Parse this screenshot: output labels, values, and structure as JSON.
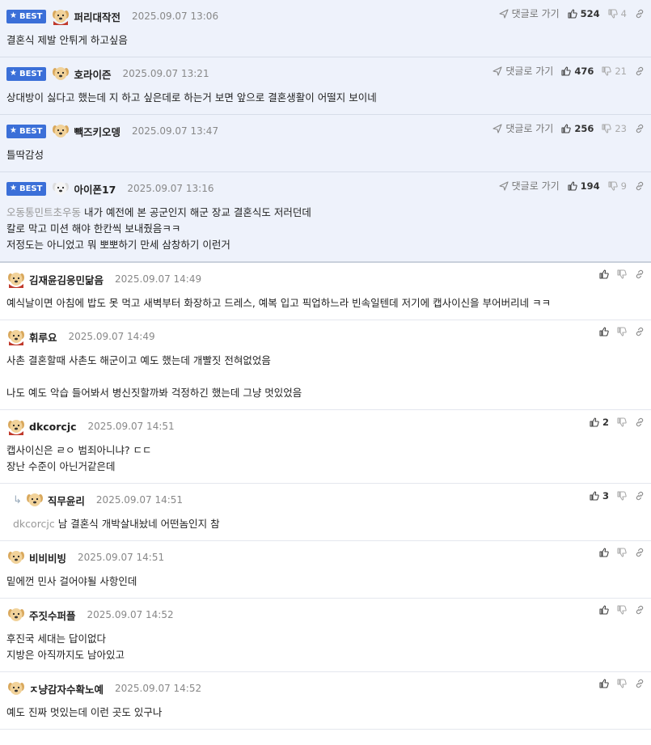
{
  "labels": {
    "best": "BEST",
    "goto": "댓글로 가기"
  },
  "best_comments": [
    {
      "nick": "퍼리대작전",
      "date": "2025.09.07 13:06",
      "up": "524",
      "down": "4",
      "lines": [
        "결혼식 제발 안튀게 하고싶음"
      ]
    },
    {
      "nick": "호라이즌",
      "date": "2025.09.07 13:21",
      "up": "476",
      "down": "21",
      "lines": [
        "상대방이 싫다고 했는데 지 하고 싶은데로 하는거 보면 앞으로 결혼생활이 어떨지 보이네"
      ]
    },
    {
      "nick": "빽즈키오뎅",
      "date": "2025.09.07 13:47",
      "up": "256",
      "down": "23",
      "lines": [
        "틀딱감성"
      ]
    },
    {
      "nick": "아이폰17",
      "date": "2025.09.07 13:16",
      "up": "194",
      "down": "9",
      "mention": "오동통민트초우동",
      "lines": [
        "내가 예전에 본 공군인지 해군 장교 결혼식도 저러던데",
        "칼로 막고 미션 해야 한칸씩 보내줬음ㅋㅋ",
        "저정도는 아니었고 뭐 뽀뽀하기 만세 삼창하기 이런거"
      ]
    }
  ],
  "comments": [
    {
      "nick": "김재윤김응민닮음",
      "date": "2025.09.07 14:49",
      "up": "",
      "lines": [
        "예식날이면 아침에 밥도 못 먹고 새벽부터 화장하고 드레스, 예복 입고 픽업하느라 빈속일텐데 저기에 캡사이신을 부어버리네 ㅋㅋ"
      ]
    },
    {
      "nick": "휘루요",
      "date": "2025.09.07 14:49",
      "up": "",
      "lines": [
        "사촌 결혼할때 사촌도 해군이고 예도 했는데 개빨짓 전혀없었음",
        "",
        "나도 예도 악습 들어봐서 병신짓할까봐 걱정하긴 했는데 그냥 멋있었음"
      ]
    },
    {
      "nick": "dkcorcjc",
      "date": "2025.09.07 14:51",
      "up": "2",
      "lines": [
        "캡사이신은 ㄹㅇ 범죄아니냐? ㄷㄷ",
        "장난 수준이 아닌거같은데"
      ]
    },
    {
      "nick": "직무윤리",
      "date": "2025.09.07 14:51",
      "up": "3",
      "reply": true,
      "mention": "dkcorcjc",
      "lines": [
        "남 결혼식 개박살내놨네 어떤놈인지 참"
      ]
    },
    {
      "nick": "비비비빙",
      "date": "2025.09.07 14:51",
      "up": "",
      "lines": [
        "밑에껀 민사 걸어야될 사항인데"
      ]
    },
    {
      "nick": "주짓수퍼플",
      "date": "2025.09.07 14:52",
      "up": "",
      "lines": [
        "후진국 세대는 답이없다",
        "지방은 아직까지도 남아있고"
      ]
    },
    {
      "nick": "ㅈ냥감자수확노예",
      "date": "2025.09.07 14:52",
      "up": "",
      "lines": [
        "예도 진짜 멋있는데 이런 곳도 있구나"
      ]
    }
  ],
  "colors": {
    "best_bg": "#eef2fb",
    "badge": "#3b6fd8",
    "muted": "#888888",
    "mention": "#999999"
  },
  "icons": [
    "star-icon",
    "dog-avatar-icon",
    "send-icon",
    "thumbs-up-icon",
    "thumbs-down-icon",
    "link-icon",
    "reply-arrow-icon"
  ]
}
